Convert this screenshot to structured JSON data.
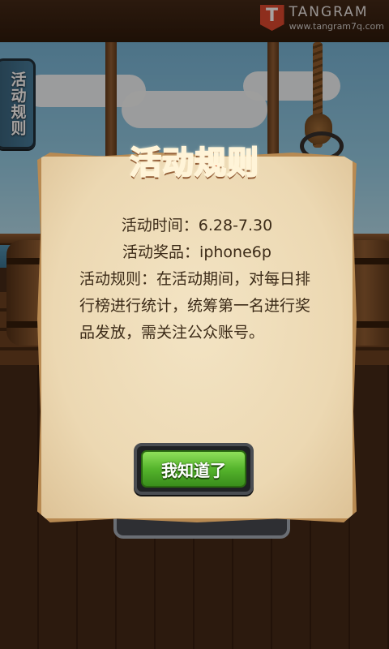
{
  "brand": {
    "logo_letter": "T",
    "name": "TANGRAM",
    "url": "www.tangram7q.com",
    "color": "#d8442c"
  },
  "side_tab": {
    "label": "活动规则"
  },
  "dialog": {
    "title": "活动规则",
    "time_line": "活动时间：6.28-7.30",
    "prize_line": "活动奖品：iphone6p",
    "rules_text": "活动规则：在活动期间，对每日排行榜进行统计，统筹第一名进行奖品发放，需关注公众账号。",
    "confirm_button": "我知道了"
  },
  "colors": {
    "title": "#d9491a",
    "parchment": "#ecd8b2",
    "button_green": "#55b42c",
    "side_tab": "#3d7a9c"
  }
}
